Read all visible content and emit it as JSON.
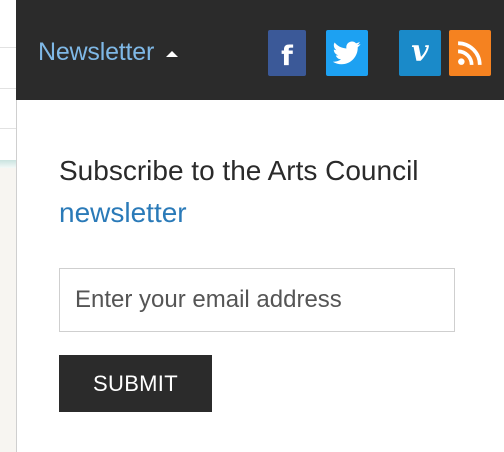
{
  "topbar": {
    "toggle_label": "Newsletter",
    "social": [
      {
        "name": "facebook",
        "icon": "facebook-icon",
        "glyph": "f",
        "color": "#3b5998"
      },
      {
        "name": "twitter",
        "icon": "twitter-icon",
        "color": "#1da1f2"
      },
      {
        "name": "vimeo",
        "icon": "vimeo-icon",
        "glyph": "v",
        "color": "#1a8ac9"
      },
      {
        "name": "rss",
        "icon": "rss-icon",
        "color": "#f58220"
      }
    ]
  },
  "dropdown": {
    "heading_prefix": "Subscribe to the Arts Council ",
    "heading_link": "newsletter",
    "email_placeholder": "Enter your email address",
    "email_value": "",
    "submit_label": "SUBMIT"
  },
  "colors": {
    "bar_bg": "#2b2b2b",
    "link": "#2a7ab8",
    "toggle_text": "#7fb8e6",
    "button_bg": "#2b2b2b"
  }
}
